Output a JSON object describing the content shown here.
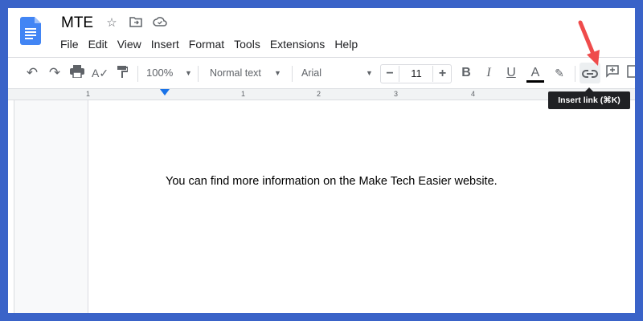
{
  "doc": {
    "title": "MTE",
    "menu": [
      "File",
      "Edit",
      "View",
      "Insert",
      "Format",
      "Tools",
      "Extensions",
      "Help"
    ]
  },
  "toolbar": {
    "zoom": "100%",
    "style": "Normal text",
    "font": "Arial",
    "font_size": "11",
    "minus": "−",
    "plus": "+",
    "bold": "B",
    "italic": "I",
    "underline": "U",
    "text_color": "A",
    "text_color_hex": "#000000"
  },
  "ruler": {
    "labels": [
      "1",
      "1",
      "2",
      "3",
      "4"
    ]
  },
  "body": {
    "text": "You can find more information on the Make Tech Easier website."
  },
  "tooltip": {
    "text": "Insert link (⌘K)"
  },
  "colors": {
    "frame": "#3a63c8",
    "docs_blue": "#4285f4",
    "arrow": "#ef4b4b"
  }
}
